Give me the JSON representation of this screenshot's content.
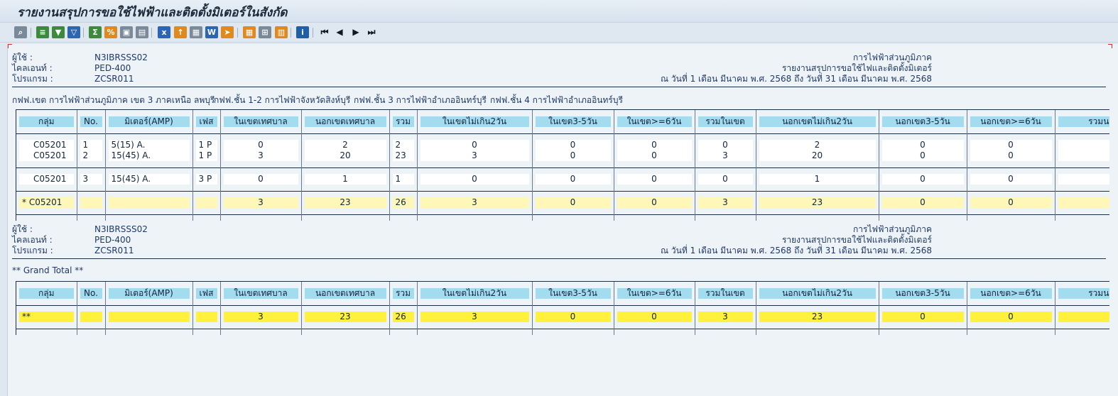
{
  "title": "รายงานสรุปการขอใช้ไฟฟ้าและติดตั้งมิเตอร์ในสังกัด",
  "toolbar": {
    "icons": [
      "magnifier-icon",
      "print-icon",
      "filter-icon",
      "filter-set-icon",
      "sum-icon",
      "subtotal-icon",
      "layout-icon",
      "layout-select-icon",
      "excel-export-icon",
      "upload-icon",
      "file-save-icon",
      "word-icon",
      "send-icon",
      "grid-icon",
      "insert-grid-icon",
      "calc-icon",
      "info-icon",
      "first-page-icon",
      "prev-page-icon",
      "next-page-icon",
      "last-page-icon"
    ],
    "info_label": "i"
  },
  "block1": {
    "user_label": "ผู้ใช้   :",
    "user_value": "N3IBRSSS02",
    "client_label": "ไคลเอนท์  :",
    "client_value": "PED-400",
    "program_label": "โปรแกรม  :",
    "program_value": "ZCSR011",
    "org": "การไฟฟ้าส่วนภูมิภาค",
    "report_name": "รายงานสรุปการขอใช้ไฟและติดตั้งมิเตอร์",
    "date_range": "ณ วันที่ 1 เดือน มีนาคม พ.ศ. 2568 ถึง วันที่ 31 เดือน มีนาคม พ.ศ. 2568"
  },
  "filters": [
    "กฟฟ.เขต การไฟฟ้าส่วนภูมิภาค เขต 3 ภาคเหนือ ลพบุรี",
    "กฟฟ.ชั้น 1-2 การไฟฟ้าจังหวัดสิงห์บุรี",
    "กฟฟ.ชั้น 3 การไฟฟ้าอำเภออินทร์บุรี",
    "กฟฟ.ชั้น 4 การไฟฟ้าอำเภออินทร์บุรี"
  ],
  "columns": [
    "กลุ่ม",
    "No.",
    "มิเตอร์(AMP)",
    "เฟส",
    "ในเขตเทศบาล",
    "นอกเขตเทศบาล",
    "รวม",
    "ในเขตไม่เกิน2วัน",
    "ในเขต3-5วัน",
    "ในเขต>=6วัน",
    "รวมในเขต",
    "นอกเขตไม่เกิน2วัน",
    "นอกเขต3-5วัน",
    "นอกเขต>=6วัน",
    "รวมนอก"
  ],
  "rows_group1": [
    [
      "C05201",
      "1",
      "5(15) A.",
      "1 P",
      "0",
      "2",
      "2",
      "0",
      "0",
      "0",
      "0",
      "2",
      "0",
      "0",
      ""
    ],
    [
      "C05201",
      "2",
      "15(45) A.",
      "1 P",
      "3",
      "20",
      "23",
      "3",
      "0",
      "0",
      "3",
      "20",
      "0",
      "0",
      ""
    ]
  ],
  "rows_group2": [
    [
      "C05201",
      "3",
      "15(45) A.",
      "3 P",
      "0",
      "1",
      "1",
      "0",
      "0",
      "0",
      "0",
      "1",
      "0",
      "0",
      ""
    ]
  ],
  "subtotal_row": [
    "*  C05201",
    "",
    "",
    "",
    "3",
    "23",
    "26",
    "3",
    "0",
    "0",
    "3",
    "23",
    "0",
    "0",
    ""
  ],
  "block2": {
    "user_label": "ผู้ใช้   :",
    "user_value": "N3IBRSSS02",
    "client_label": "ไคลเอนท์  :",
    "client_value": "PED-400",
    "program_label": "โปรแกรม  :",
    "program_value": "ZCSR011",
    "org": "การไฟฟ้าส่วนภูมิภาค",
    "report_name": "รายงานสรุปการขอใช้ไฟและติดตั้งมิเตอร์",
    "date_range": "ณ วันที่ 1 เดือน มีนาคม พ.ศ. 2568 ถึง วันที่ 31 เดือน มีนาคม พ.ศ. 2568"
  },
  "grand_total_label": "** Grand Total **",
  "grand_total_row": [
    "**",
    "",
    "",
    "",
    "3",
    "23",
    "26",
    "3",
    "0",
    "0",
    "3",
    "23",
    "0",
    "0",
    ""
  ]
}
